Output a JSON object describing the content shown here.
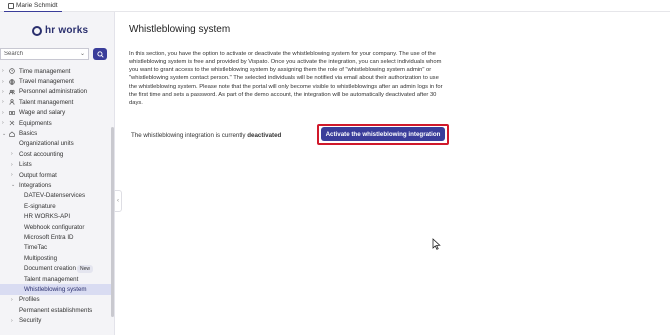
{
  "topbar": {
    "user_name": "Marie Schmidt"
  },
  "sidebar": {
    "logo_text": "hr works",
    "search": {
      "placeholder": "Search"
    },
    "items": [
      {
        "label": "Time management",
        "icon": "clock-icon"
      },
      {
        "label": "Travel management",
        "icon": "globe-icon"
      },
      {
        "label": "Personnel administration",
        "icon": "people-icon"
      },
      {
        "label": "Talent management",
        "icon": "person-icon"
      },
      {
        "label": "Wage and salary",
        "icon": "money-icon"
      },
      {
        "label": "Equipments",
        "icon": "tools-icon"
      },
      {
        "label": "Basics",
        "icon": "home-icon"
      }
    ],
    "basics_children": [
      "Organizational units",
      "Cost accounting",
      "Lists",
      "Output format",
      "Integrations"
    ],
    "integrations_children": [
      "DATEV-Datenservices",
      "E-signature",
      "HR WORKS-API",
      "Webhook configurator",
      "Microsoft Entra ID",
      "TimeTac",
      "Multiposting",
      "Document creation",
      "Talent management",
      "Whistleblowing system"
    ],
    "new_badge": "New",
    "after_items": [
      "Profiles",
      "Permanent establishments",
      "Security"
    ]
  },
  "main": {
    "title": "Whistleblowing system",
    "description": "In this section, you have the option to activate or deactivate the whistleblowing system for your company. The use of the whistleblowing system is free and provided by Vispato. Once you activate the integration, you can select individuals whom you want to grant access to the whistleblowing system by assigning them the role of \"whistleblowing system admin\" or \"whistleblowing system contact person.\" The selected individuals will be notified via email about their authorization to use the whistleblowing system. Please note that the portal will only become visible to whistleblowings after an admin logs in for the first time and sets a password. As part of the demo account, the integration will be automatically deactivated after 30 days.",
    "status_prefix": "The whistleblowing integration is currently",
    "status_value": "deactivated",
    "activate_label": "Activate the whistleblowing integration"
  },
  "colors": {
    "accent": "#3a3d9a",
    "highlight_outline": "#d0192b",
    "active_nav": "#d9dcf2"
  }
}
